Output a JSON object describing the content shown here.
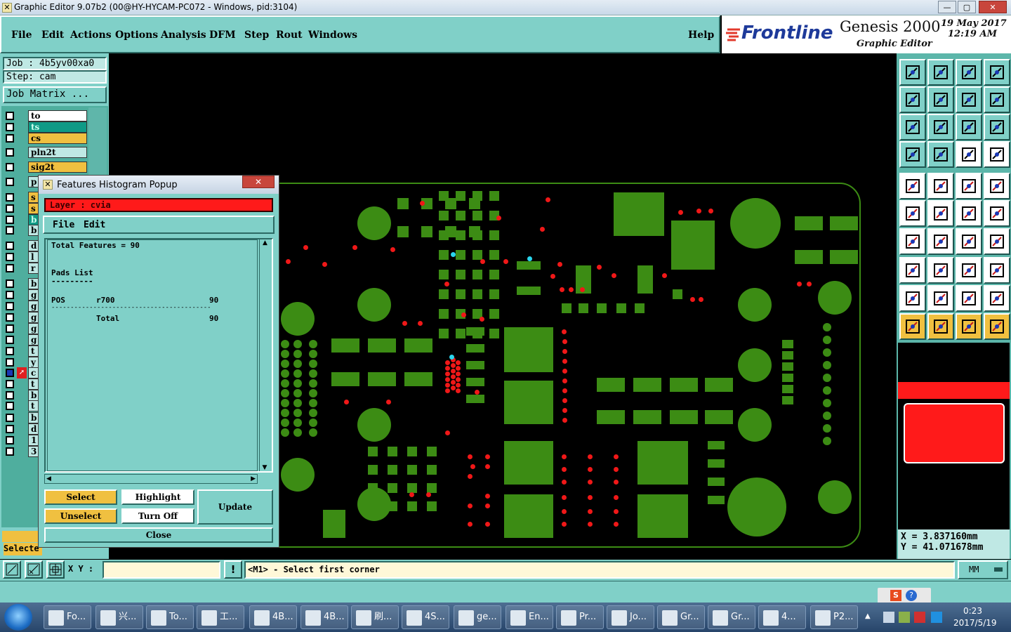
{
  "window": {
    "title": "Graphic Editor 9.07b2 (00@HY-HYCAM-PC072 - Windows, pid:3104)",
    "min": "—",
    "max": "▢",
    "close": "✕"
  },
  "menu": {
    "items": [
      "File",
      "Edit",
      "Actions",
      "Options",
      "Analysis",
      "DFM",
      "Step",
      "Rout",
      "Windows"
    ],
    "help": "Help"
  },
  "brand": {
    "logo": "Frontline",
    "product": "Genesis 2000",
    "sub": "Graphic Editor",
    "date": "19 May 2017",
    "time": "12:19 AM"
  },
  "job": {
    "job": "Job : 4b5yv00xa0",
    "step": "Step: cam",
    "matrix": "Job Matrix ..."
  },
  "layers": [
    {
      "name": "to",
      "color": "#ffffff"
    },
    {
      "name": "ts",
      "color": "#0f9a86"
    },
    {
      "name": "cs",
      "color": "#f0c040"
    },
    {
      "name": "pln2t",
      "color": "#bfe8e4"
    },
    {
      "name": "sig2t",
      "color": "#f0c040"
    },
    {
      "name": "p",
      "color": "#bfe8e4"
    },
    {
      "name": "s",
      "color": "#f0c040"
    },
    {
      "name": "s",
      "color": "#f0c040"
    },
    {
      "name": "b",
      "color": "#0f9a86"
    },
    {
      "name": "b",
      "color": "#bfe8e4"
    },
    {
      "name": "d",
      "color": "#bfe8e4"
    },
    {
      "name": "l",
      "color": "#bfe8e4"
    },
    {
      "name": "r",
      "color": "#bfe8e4"
    },
    {
      "name": "b",
      "color": "#bfe8e4"
    },
    {
      "name": "g",
      "color": "#bfe8e4"
    },
    {
      "name": "g",
      "color": "#bfe8e4"
    },
    {
      "name": "g",
      "color": "#bfe8e4"
    },
    {
      "name": "g",
      "color": "#bfe8e4"
    },
    {
      "name": "g",
      "color": "#bfe8e4"
    },
    {
      "name": "t",
      "color": "#bfe8e4"
    },
    {
      "name": "y",
      "color": "#bfe8e4"
    },
    {
      "name": "c",
      "color": "#bfe8e4"
    },
    {
      "name": "t",
      "color": "#bfe8e4"
    },
    {
      "name": "b",
      "color": "#bfe8e4"
    },
    {
      "name": "t",
      "color": "#bfe8e4"
    },
    {
      "name": "b",
      "color": "#bfe8e4"
    },
    {
      "name": "d",
      "color": "#bfe8e4"
    },
    {
      "name": "1",
      "color": "#bfe8e4"
    },
    {
      "name": "3",
      "color": "#bfe8e4"
    }
  ],
  "selected_label": "Selecte",
  "popup": {
    "title": "Features Histogram Popup",
    "layer": "Layer : cvia",
    "menu": [
      "File",
      "Edit"
    ],
    "total": "Total Features = 90",
    "pads_title": "Pads List",
    "pads_rule": "---------",
    "row": {
      "pol": "POS",
      "sym": "r700",
      "count": "90"
    },
    "sep": "------------------------------------------",
    "total_row": {
      "label": "Total",
      "count": "90"
    },
    "buttons": {
      "select": "Select",
      "highlight": "Highlight",
      "update": "Update",
      "unselect": "Unselect",
      "turnoff": "Turn Off",
      "close": "Close"
    }
  },
  "coords": {
    "x": "X = 3.837160mm",
    "y": "Y = 41.071678mm"
  },
  "cmd": {
    "xy_label": "X Y :",
    "xy_value": "",
    "prompt": "<M1> - Select first corner",
    "units": "MM",
    "excl": "!"
  },
  "taskbar": {
    "items": [
      "Fo...",
      "兴...",
      "To...",
      "工...",
      "4B...",
      "4B...",
      "刷...",
      "4S...",
      "ge...",
      "En...",
      "Pr...",
      "Jo...",
      "Gr...",
      "Gr...",
      "4...",
      "P2..."
    ],
    "time": "0:23",
    "date": "2017/5/19"
  },
  "colors": {
    "teal": "#80d0c8",
    "pcb": "#3c8c14",
    "drill": "#f01818",
    "highlight": "#ff1a1a"
  }
}
